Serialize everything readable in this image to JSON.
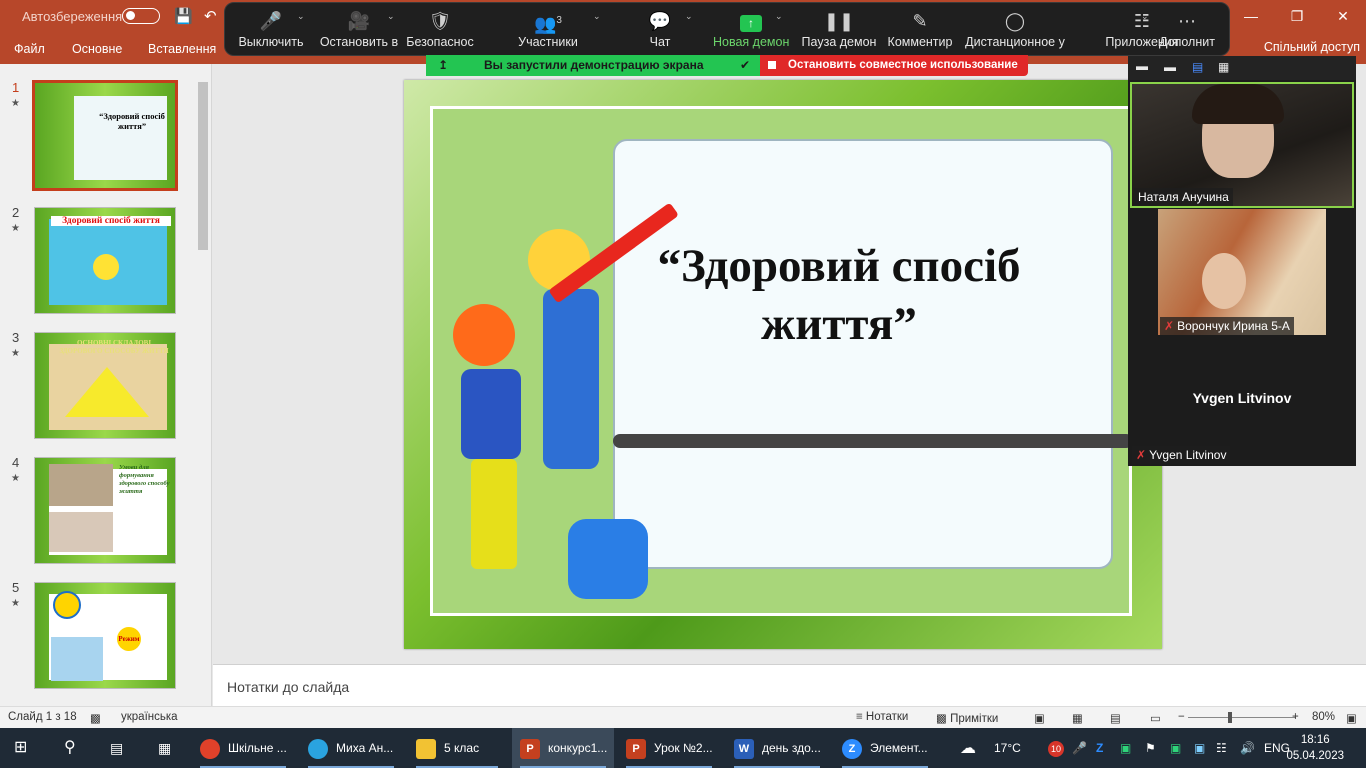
{
  "ppt": {
    "autosave_label": "Автозбереження",
    "tabs": [
      "Файл",
      "Основне",
      "Вставлення"
    ],
    "share_label": "Спільний доступ"
  },
  "zoom_toolbar": {
    "mute": "Выключить",
    "video": "Остановить в",
    "security": "Безопаснос",
    "participants": "Участники",
    "participants_count": "3",
    "chat": "Чат",
    "new_share": "Новая демон",
    "pause_share": "Пауза демон",
    "annotate": "Комментир",
    "remote": "Дистанционное у",
    "apps": "Приложения",
    "more": "Дополнит"
  },
  "share_banner": {
    "message": "Вы запустили демонстрацию экрана",
    "stop": "Остановить совместное использование"
  },
  "slides": [
    {
      "num": "1",
      "caption": "“Здоровий спосіб життя”"
    },
    {
      "num": "2",
      "caption": "Здоровий спосіб життя"
    },
    {
      "num": "3",
      "caption": "ОСНОВНІ СКЛАДОВІ ЗДОРОВОГО СПОСОБУ ЖИТТЯ"
    },
    {
      "num": "4",
      "caption": "Умови для формування здорового способу життя"
    },
    {
      "num": "5",
      "caption": "Режим дня"
    }
  ],
  "slide_title": "“Здоровий спосіб життя”",
  "notes_placeholder": "Нотатки до слайда",
  "status": {
    "slide_of": "Слайд 1 з 18",
    "language": "українська",
    "notes": "Нотатки",
    "comments": "Примітки",
    "zoom": "80%"
  },
  "video_panel": {
    "participants": [
      {
        "name": "Наталя Анучина",
        "muted": false
      },
      {
        "name": "Ворончук Ирина 5-А",
        "muted": true
      },
      {
        "name": "Yvgen Litvinov",
        "muted": true
      }
    ],
    "camera_off_name": "Yvgen Litvinov"
  },
  "taskbar": {
    "items": [
      {
        "label": "Шкільне ...",
        "icon": "chrome-icon"
      },
      {
        "label": "Миха Ан...",
        "icon": "telegram-icon",
        "badge": "10"
      },
      {
        "label": "5 клас",
        "icon": "folder-icon"
      },
      {
        "label": "конкурс1...",
        "icon": "powerpoint-icon"
      },
      {
        "label": "Урок №2...",
        "icon": "powerpoint-icon"
      },
      {
        "label": "день здо...",
        "icon": "word-icon"
      },
      {
        "label": "Элемент...",
        "icon": "zoom-icon"
      }
    ],
    "weather": "17°C",
    "tray_badge": "10",
    "lang": "ENG",
    "time": "18:16",
    "date": "05.04.2023"
  },
  "colors": {
    "ppt_accent": "#b7472a",
    "zoom_green": "#23c552",
    "zoom_red": "#e02828"
  }
}
